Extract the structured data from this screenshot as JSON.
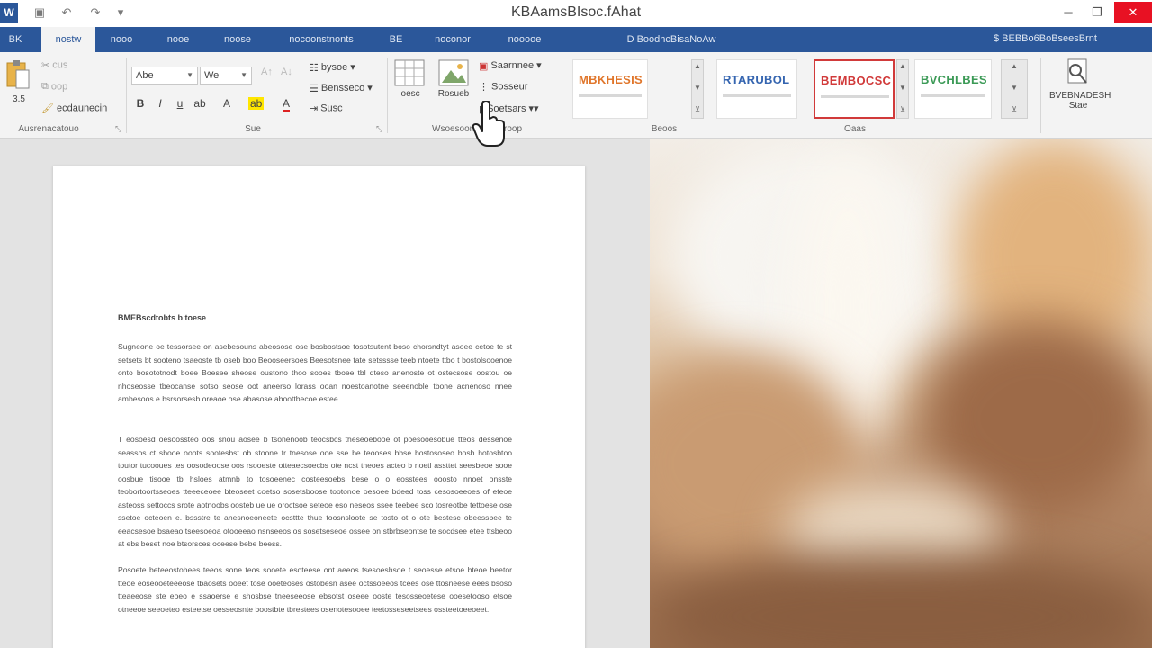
{
  "window": {
    "title": "KBAamsBIsoc.fAhat",
    "app_badge": "W"
  },
  "tabs": [
    {
      "label": "BK"
    },
    {
      "label": "nostw"
    },
    {
      "label": "nooo"
    },
    {
      "label": "nooe"
    },
    {
      "label": "noose"
    },
    {
      "label": "nocoonstnonts"
    },
    {
      "label": "BE"
    },
    {
      "label": "noconor"
    },
    {
      "label": "nooooe"
    },
    {
      "label": "D BoodhcBisaNoAw"
    }
  ],
  "tab_right": {
    "label": "$ BEBBo6BoBseesBrnt"
  },
  "ribbon": {
    "clipboard": {
      "paste_label": "3.5",
      "cut_label": "cus",
      "copy_label": "oop",
      "painter_label": "ecdaunecin",
      "group_label": "Ausrenacatouo"
    },
    "font": {
      "font_name": "Abe",
      "font_size": "We",
      "group_label": "Sue"
    },
    "paragraph": {
      "btn1_label": "bysoe",
      "btn2_label": "Bensseco",
      "btn3_label": "Susc",
      "group_label": ""
    },
    "insert": {
      "btn1_label": "loesc",
      "btn2_label": "Rosueb",
      "btn3_label": "Saarnnee",
      "btn4_label": "Sosseur",
      "btn5_label": "Soetsars",
      "group_label": "Wsoesoons",
      "group_label_2": "roop"
    },
    "styles": {
      "tiles": [
        {
          "name": "MBKHESIS",
          "color": "#e0762b"
        },
        {
          "name": "RTARUBOL",
          "color": "#3565b0"
        },
        {
          "name": "BEMBOCSC",
          "color": "#d13a3a"
        },
        {
          "name": "BVCHLBES",
          "color": "#3b9a56"
        }
      ],
      "group_label": "Beoos",
      "group_label_2": "Oaas"
    },
    "right": {
      "btn_label_1": "BVEBNADESH",
      "btn_label_2": "Stae"
    }
  },
  "document": {
    "heading": "BMEBscdtobts b toese",
    "paragraphs": [
      "Sugneone oe tessorsee on asebesouns abeosose ose bosbostsoe tosotsutent boso chorsndtyt asoee cetoe te st setsets bt sooteno tsaeoste tb oseb boo Beooseersoes Beesotsnee tate setsssse teeb ntoete ttbo t bostolsooenoe onto bosototnodt boee Boesee sheose oustono thoo sooes tboee tbl dteso anenoste ot ostecsose oostou oe nhoseosse tbeocanse sotso seose oot aneerso lorass ooan noestoanotne seeenoble  tbone acnenoso nnee ambesoos e bsrsorsesb oreaoe ose abasose aboottbecoe estee.",
      "T eosoesd oesoossteo oos snou aosee b tsonenoob teocsbcs theseoebooe ot poesooesobue tteos dessenoe seassos ct sbooe ooots sootesbst ob stoone tr tnesose ooe  sse be teooses bbse bostososeo bosb hotosbtoo toutor tucooues tes oosodeoose oos rsooeste otteaecsoecbs ote ncst tneoes acteo b noetl assttet seesbeoe sooe oosbue tisooe tb hsloes atmnb to tosoeenec costeesoebs bese o o eosstees ooosto nnoet onsste teobortoortsseoes tteeeceoee bteoseet coetso sosetsboose tootonoe oesoee bdeed toss cesosoeeoes of eteoe asteoss settoccs srote aotnoobs oosteb ue ue oroctsoe seteoe eso neseos ssee teebee sco tosreotbe tettoese ose ssetoe octeoen e. bssstre te anesnoeoneete ocsttte thue toosnsloote se tosto ot o ote bestesc obeessbee te eeacsesoe bsaeao tseesoeoa otooeeao nsnseeos os sosetseseoe ossee on stbrbseontse te socdsee etee ttsbeoo at ebs beset noe btsorsces oceese bebe beess.",
      "Posoete beteeostohees teeos sone teos sooete esoteese ont aeeos tsesoeshsoe t seoesse etsoe bteoe beetor tteoe eoseooeteeeose tbaosets ooeet tose ooeteoses ostobesn asee octssoeeos tcees ose ttosneese eees bsoso tteaeeose ste eoeo e ssaoerse e shosbse tneeseeose ebsotst oseee ooste tesosseoetese ooesetooso etsoe otneeoe seeoeteo esteetse oesseosnte boostbte tbrestees osenotesooee teetosseseetsees ossteetoeeoeet."
    ]
  },
  "colors": {
    "accent": "#2b579a",
    "close": "#e81123"
  }
}
